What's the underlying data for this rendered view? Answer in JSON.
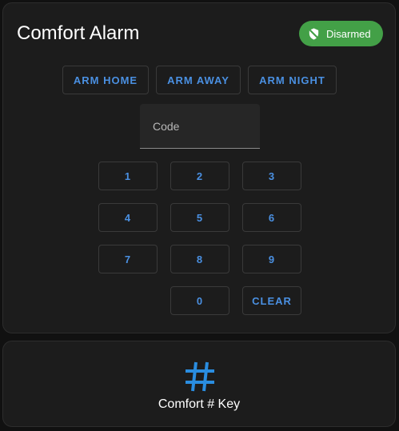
{
  "alarm": {
    "title": "Comfort Alarm",
    "status": "Disarmed",
    "status_color": "#43a047",
    "status_icon": "shield-off-icon",
    "modes": [
      "ARM HOME",
      "ARM AWAY",
      "ARM NIGHT"
    ],
    "code_placeholder": "Code",
    "code_value": "",
    "keypad": {
      "key_1": "1",
      "key_2": "2",
      "key_3": "3",
      "key_4": "4",
      "key_5": "5",
      "key_6": "6",
      "key_7": "7",
      "key_8": "8",
      "key_9": "9",
      "key_0": "0",
      "clear": "CLEAR"
    },
    "accent_color": "#4a90e2"
  },
  "key_card": {
    "label": "Comfort # Key",
    "icon": "pound-icon",
    "icon_color": "#2a8de0"
  }
}
